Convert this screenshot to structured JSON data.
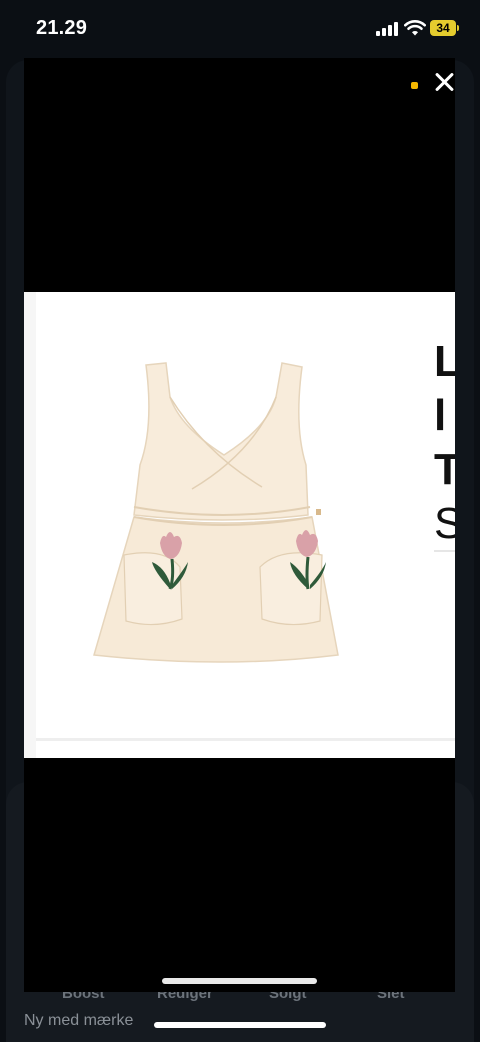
{
  "status_bar": {
    "time": "21.29",
    "battery": "34"
  },
  "viewer": {
    "image_alt": "Cream sleeveless wrap dress with embroidered tulip pockets",
    "clipped_lines": [
      "L",
      "l",
      "T",
      "S"
    ]
  },
  "background": {
    "actions": [
      "Boost",
      "Rediger",
      "Solgt",
      "Slet"
    ],
    "subtitle": "Ny med mærke"
  },
  "colors": {
    "battery": "#e5cc2e",
    "indicator": "#f5b800",
    "dress": "#f7ead7"
  }
}
